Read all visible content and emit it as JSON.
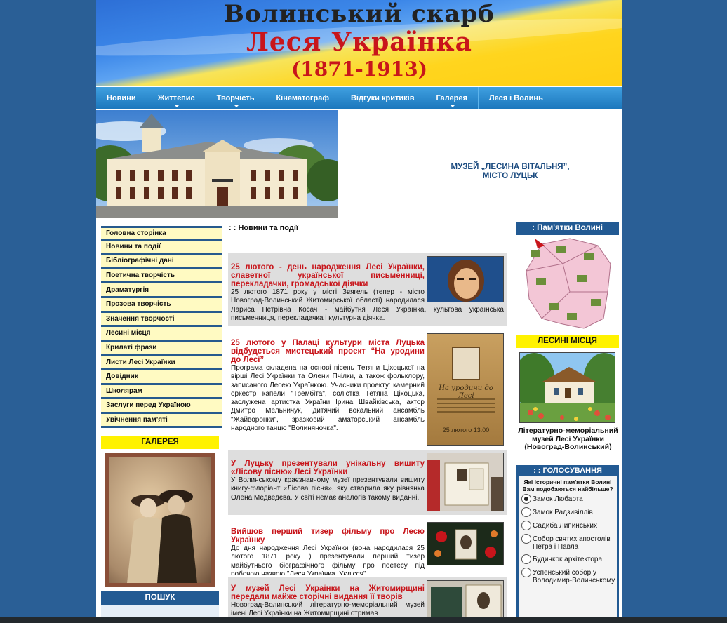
{
  "banner": {
    "line1": "Волинський скарб",
    "line2": "Леся Українка",
    "line3": "(1871-1913)"
  },
  "nav": [
    {
      "label": "Новини",
      "has_sub": false
    },
    {
      "label": "Життєпис",
      "has_sub": true
    },
    {
      "label": "Творчість",
      "has_sub": true
    },
    {
      "label": "Кінематограф",
      "has_sub": false
    },
    {
      "label": "Відгуки критиків",
      "has_sub": false
    },
    {
      "label": "Галерея",
      "has_sub": true
    },
    {
      "label": "Леся і Волинь",
      "has_sub": false
    }
  ],
  "hero": {
    "caption_line1": "МУЗЕЙ „ЛЕСИНА ВІТАЛЬНЯ”,",
    "caption_line2": "МІСТО ЛУЦЬК"
  },
  "sidebar_menu": [
    "Головна сторінка",
    "Новини та події",
    "Бібліографічні дані",
    "Поетична творчість",
    "Драматургія",
    "Прозова творчість",
    "Значення творчості",
    "Лесині місця",
    "Крилаті фрази",
    "Листи Лесі Українки",
    "Довідник",
    "Школярам",
    "Заслуги перед Україною",
    "Увічнення пам'яті"
  ],
  "gallery": {
    "heading": "ГАЛЕРЕЯ"
  },
  "search": {
    "heading": "ПОШУК"
  },
  "news_section_title": ": : Новини та події",
  "news": [
    {
      "title": "25 лютого - день народження Лесі Українки, славетної української письменниці, перекладачки, громадської діячки",
      "body": "25 лютого 1871 року у місті Звягель (тепер - місто Новоград-Волинський Житомирської області) народилася Лариса Петрівна Косач - майбутня Леся Українка, культова українська письменниця, перекладачка і культурна діячка."
    },
    {
      "title": "25 лютого у Палаці культури міста Луцька відбудеться мистецький проект “На уродини до Лесі”",
      "body": "Програма складена на основі пісень Тетяни Ціхоцької на вірші Лесі Українки та Олени Пчілки, а також фольклору, записаного Лесею Українкою. Учасники проекту: камерний оркестр капели \"Трембіта\", солістка Тетяна Ціхоцька, заслужена артистка України Ірина Швайківська, актор Дмитро Мельничук, дитячий вокальний ансамбль \"Жайворонки\", зразковий аматорський ансамбль народного танцю \"Волиняночка\".",
      "poster_title": "На уродини до Лесі",
      "poster_date": "25 лютого 13:00"
    },
    {
      "title": "У Луцьку презентували унікальну вишиту «Лісову пісню» Лесі Українки",
      "body": "У Волинському краєзнавчому музеї презентували вишиту книгу-флоріант «Лісова пісня», яку створила яку рівнянка Олена Медведєва. У світі немає аналогів такому виданні."
    },
    {
      "title": "Вийшов перший тизер фільму про Лесю Українку",
      "body": "До дня народження Лесі Українки (вона народилася 25 лютого 1871 року ) презентували перший тизер майбутнього біографічного фільму про поетесу під робочою назвою \"Леся Українка. Уєлісся\"."
    },
    {
      "title": "У музей Лесі Українки на Житомирщині передали майже сторічні видання її творів",
      "body": "Новоград-Волинський літературно-меморіальний музей імені Лесі Українки на Житомирщині отримав"
    }
  ],
  "right": {
    "monuments_heading": ": Пам'ятки Волині",
    "lesin_heading": "ЛЕСИНІ МІСЦЯ",
    "lesin_caption": "Літературно-меморіальний музей Лесі Українки (Новоград-Волинський)",
    "poll": {
      "heading": ": : ГОЛОСУВАННЯ",
      "question": "Які історичні пам'ятки Волині Вам подобаються найбільше?",
      "options": [
        {
          "label": "Замок Любарта",
          "selected": true
        },
        {
          "label": "Замок Радзивіллів",
          "selected": false
        },
        {
          "label": "Садиба Липинських",
          "selected": false
        },
        {
          "label": "Собор святих апостолів Петра і Павла",
          "selected": false
        },
        {
          "label": "Будинкок архітектора",
          "selected": false
        },
        {
          "label": "Успенський собор у Володимир-Волинському",
          "selected": false
        }
      ]
    }
  },
  "colors": {
    "page_bg": "#2a5f96",
    "accent_red": "#c8151b",
    "menu_bg": "#fffac2",
    "yellow_head": "#fff200",
    "blue_head": "#225a93"
  }
}
